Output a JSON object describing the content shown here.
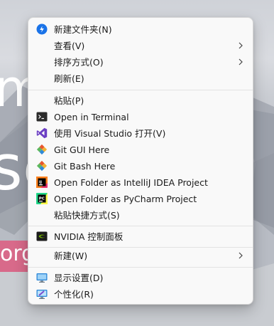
{
  "background": {
    "word_top": "m",
    "word_bottom": "se",
    "pill_text": "org"
  },
  "menu": {
    "items": [
      {
        "label": "新建文件夹(N)",
        "icon": "new-folder-icon"
      },
      {
        "label": "查看(V)",
        "icon": "",
        "submenu": true
      },
      {
        "label": "排序方式(O)",
        "icon": "",
        "submenu": true
      },
      {
        "label": "刷新(E)",
        "icon": ""
      },
      {
        "label": "粘贴(P)",
        "icon": ""
      },
      {
        "label": "Open in Terminal",
        "icon": "terminal-icon"
      },
      {
        "label": "使用 Visual Studio 打开(V)",
        "icon": "visual-studio-icon"
      },
      {
        "label": "Git GUI Here",
        "icon": "git-gui-icon"
      },
      {
        "label": "Git Bash Here",
        "icon": "git-bash-icon"
      },
      {
        "label": "Open Folder as IntelliJ IDEA Project",
        "icon": "intellij-idea-icon"
      },
      {
        "label": "Open Folder as PyCharm Project",
        "icon": "pycharm-icon"
      },
      {
        "label": "粘贴快捷方式(S)",
        "icon": ""
      },
      {
        "label": "NVIDIA 控制面板",
        "icon": "nvidia-icon"
      },
      {
        "label": "新建(W)",
        "icon": "",
        "submenu": true
      },
      {
        "label": "显示设置(D)",
        "icon": "display-settings-icon"
      },
      {
        "label": "个性化(R)",
        "icon": "personalize-icon"
      }
    ]
  },
  "colors": {
    "menu_bg": "#f9f9f9",
    "accent_blue": "#1a73e8",
    "vs_purple": "#6c3fc4",
    "nvidia_green": "#76b900"
  }
}
